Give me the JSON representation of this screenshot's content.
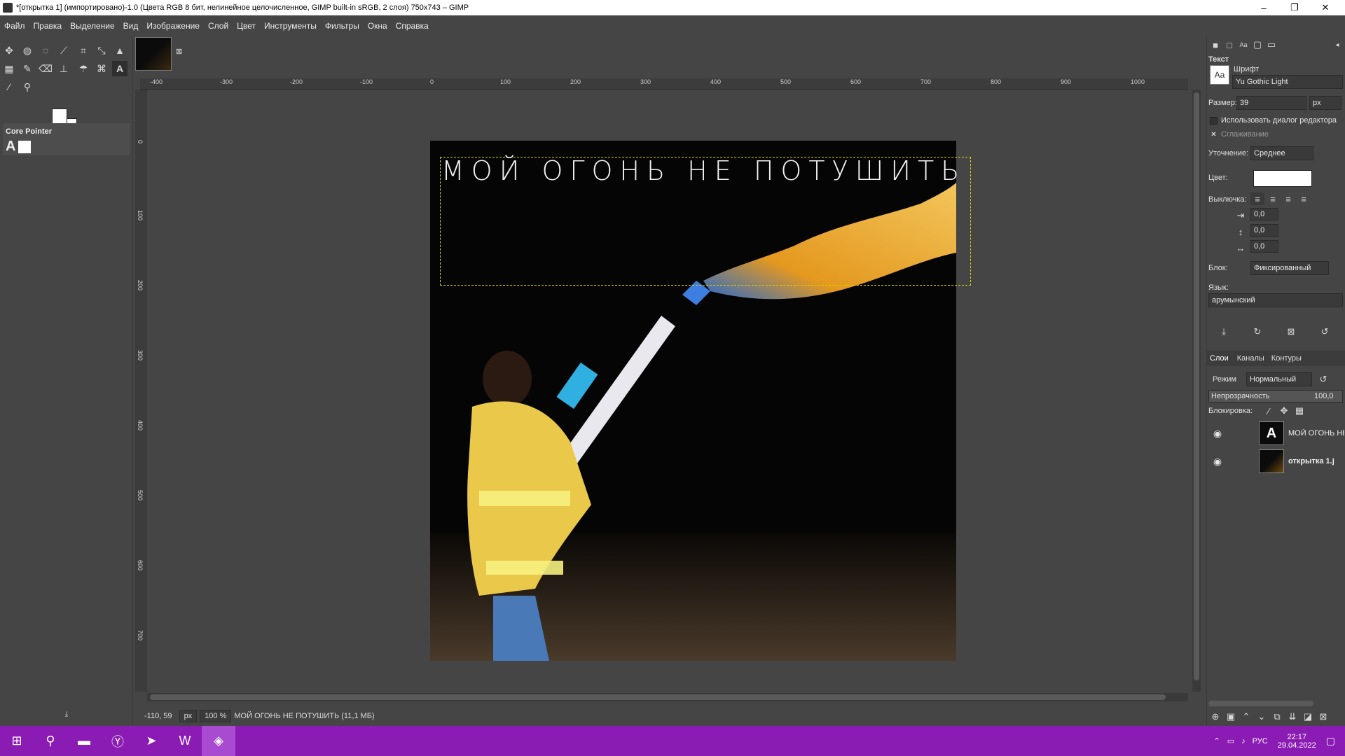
{
  "window": {
    "title": "*[открытка 1] (импортировано)-1.0 (Цвета RGB 8 бит, нелинейное целочисленное, GIMP built-in sRGB, 2 слоя) 750x743 – GIMP",
    "minimize": "–",
    "maximize": "❐",
    "close": "✕"
  },
  "menu": [
    "Файл",
    "Правка",
    "Выделение",
    "Вид",
    "Изображение",
    "Слой",
    "Цвет",
    "Инструменты",
    "Фильтры",
    "Окна",
    "Справка"
  ],
  "tool_options": {
    "title": "Core Pointer"
  },
  "rulers": {
    "horizontal": [
      "-400",
      "-300",
      "-200",
      "-100",
      "0",
      "100",
      "200",
      "300",
      "400",
      "500",
      "600",
      "700",
      "800",
      "900",
      "1000"
    ],
    "vertical": [
      "0",
      "100",
      "200",
      "300",
      "400",
      "500",
      "600",
      "700"
    ]
  },
  "canvas": {
    "overlay_text": "МОЙ ОГОНЬ НЕ ПОТУШИТЬ"
  },
  "status": {
    "coords": "-110, 59",
    "unit": "px",
    "zoom": "100 %",
    "message": "МОЙ ОГОНЬ НЕ ПОТУШИТЬ (11,1 МБ)"
  },
  "text_panel": {
    "title": "Текст",
    "font_label": "Шрифт",
    "font_value": "Yu Gothic Light",
    "size_label": "Размер:",
    "size_value": "39",
    "size_unit": "px",
    "use_editor": "Использовать диалог редактора",
    "antialias": "Сглаживание",
    "hinting_label": "Уточнение:",
    "hinting_value": "Среднее",
    "color_label": "Цвет:",
    "justify_label": "Выключка:",
    "indent": "0,0",
    "line_spacing": "0,0",
    "letter_spacing": "0,0",
    "box_label": "Блок:",
    "box_value": "Фиксированный",
    "language_label": "Язык:",
    "language_value": "арумынский"
  },
  "layers_panel": {
    "tabs": [
      "Слои",
      "Каналы",
      "Контуры"
    ],
    "mode_label": "Режим",
    "mode_value": "Нормальный",
    "opacity_label": "Непрозрачность",
    "opacity_value": "100,0",
    "lock_label": "Блокировка:",
    "layers": [
      {
        "name": "МОЙ ОГОНЬ НЕ"
      },
      {
        "name": "открытка 1.j"
      }
    ]
  },
  "taskbar": {
    "language": "РУС",
    "time": "22:17",
    "date": "29.04.2022"
  },
  "colors": {
    "accent_taskbar": "#8a1bb3",
    "selection_frame": "#d4d400"
  }
}
